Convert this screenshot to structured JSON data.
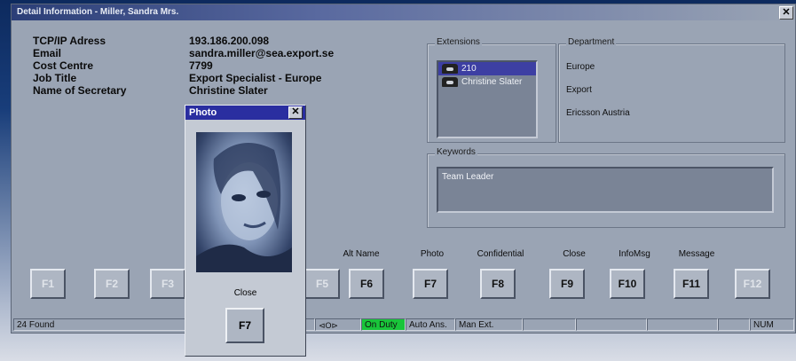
{
  "window": {
    "title": "Detail Information - Miller, Sandra  Mrs.",
    "close_glyph": "✕"
  },
  "info": [
    {
      "label": "TCP/IP Adress",
      "value": "193.186.200.098"
    },
    {
      "label": "Email",
      "value": "sandra.miller@sea.export.se"
    },
    {
      "label": "Cost Centre",
      "value": "7799"
    },
    {
      "label": "Job Title",
      "value": "Export Specialist - Europe"
    },
    {
      "label": "Name of Secretary",
      "value": "Christine Slater"
    }
  ],
  "extensions": {
    "title": "Extensions",
    "items": [
      {
        "text": "210",
        "selected": true
      },
      {
        "text": "Christine Slater",
        "selected": false
      }
    ]
  },
  "department": {
    "title": "Department",
    "lines": [
      "Europe",
      "Export",
      "Ericsson Austria"
    ]
  },
  "keywords": {
    "title": "Keywords",
    "value": "Team Leader"
  },
  "fkeys": {
    "f1": "F1",
    "f2": "F2",
    "f3": "F3",
    "f5": "F5",
    "f6": "F6",
    "f7": "F7",
    "f8": "F8",
    "f9": "F9",
    "f10": "F10",
    "f11": "F11",
    "f12": "F12",
    "labels": {
      "f6": "Alt Name",
      "f7": "Photo",
      "f8": "Confidential",
      "f9": "Close",
      "f10": "InfoMsg",
      "f11": "Message"
    }
  },
  "status": {
    "found": "24 Found",
    "icon_glyph": "⊲Ο⊳",
    "on_duty": "On Duty",
    "auto_ans": "Auto Ans.",
    "man_ext": "Man Ext.",
    "num": "NUM",
    "on_duty_color": "#19c53a"
  },
  "photo_dialog": {
    "title": "Photo",
    "close_glyph": "✕",
    "close_label": "Close",
    "close_key": "F7"
  }
}
